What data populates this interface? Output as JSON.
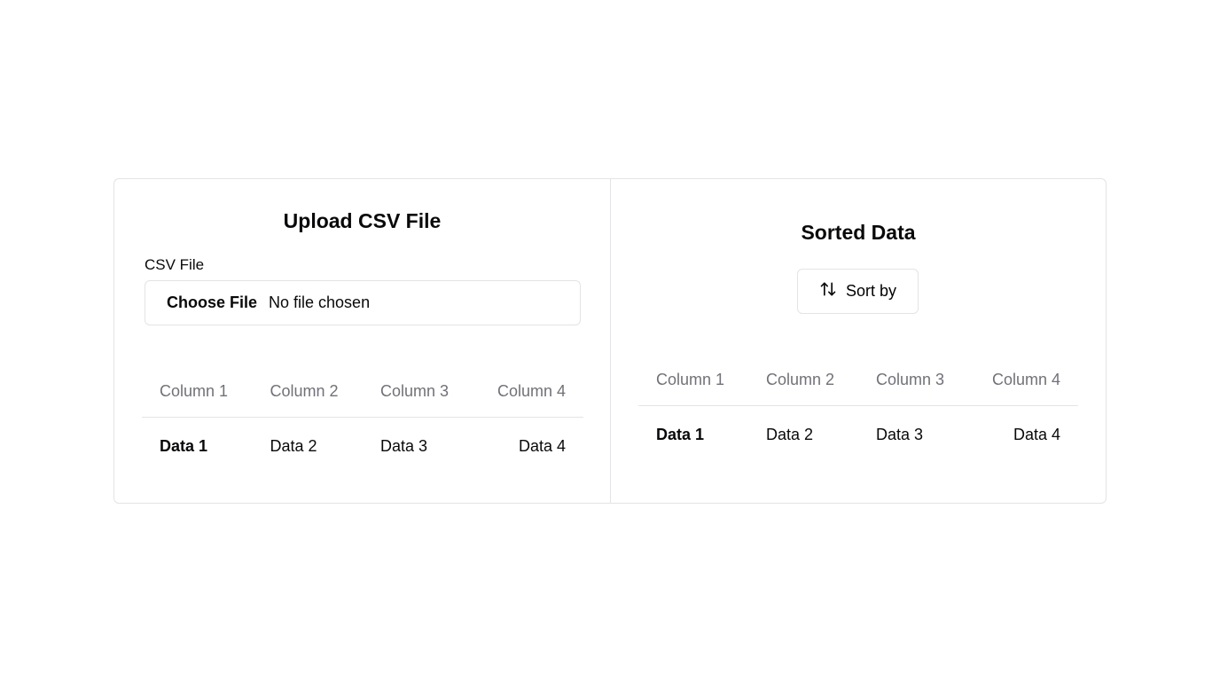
{
  "upload": {
    "title": "Upload CSV File",
    "field_label": "CSV File",
    "choose_file_label": "Choose File",
    "file_status": "No file chosen",
    "table": {
      "headers": [
        "Column 1",
        "Column 2",
        "Column 3",
        "Column 4"
      ],
      "rows": [
        [
          "Data 1",
          "Data 2",
          "Data 3",
          "Data 4"
        ]
      ]
    }
  },
  "sorted": {
    "title": "Sorted Data",
    "sort_button_label": "Sort by",
    "sort_icon": "arrow-up-down-icon",
    "table": {
      "headers": [
        "Column 1",
        "Column 2",
        "Column 3",
        "Column 4"
      ],
      "rows": [
        [
          "Data 1",
          "Data 2",
          "Data 3",
          "Data 4"
        ]
      ]
    }
  },
  "colors": {
    "border": "#e4e4e7",
    "muted_text": "#71717a",
    "text": "#09090b"
  }
}
